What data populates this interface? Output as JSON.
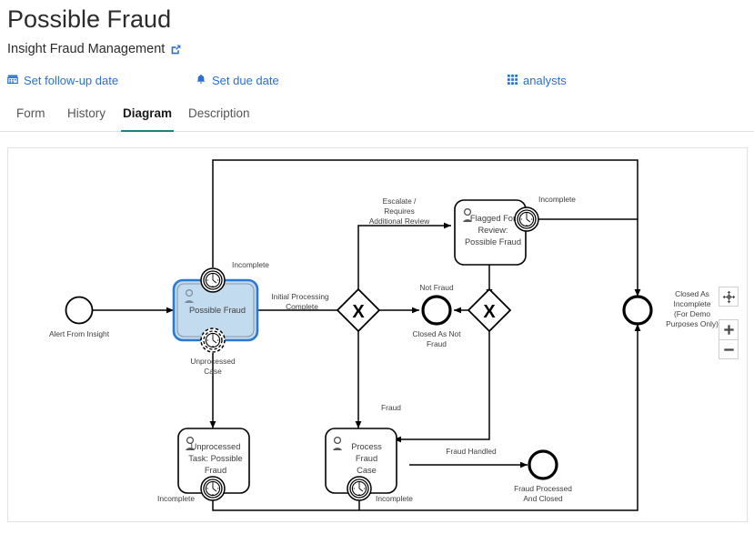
{
  "header": {
    "title": "Possible Fraud",
    "subtitle": "Insight Fraud Management",
    "subtitle_link_icon": "external-link-icon"
  },
  "quick_actions": [
    {
      "icon": "calendar-icon",
      "label": "Set follow-up date"
    },
    {
      "icon": "bell-icon",
      "label": "Set due date"
    },
    {
      "icon": "grid-apps-icon",
      "label": "analysts"
    }
  ],
  "tabs": [
    {
      "label": "Form",
      "active": false
    },
    {
      "label": "History",
      "active": false
    },
    {
      "label": "Diagram",
      "active": true
    },
    {
      "label": "Description",
      "active": false
    }
  ],
  "zoom_controls": [
    {
      "icon": "fit-to-screen-icon",
      "label": ""
    },
    {
      "icon": "plus-icon",
      "label": "+"
    },
    {
      "icon": "minus-icon",
      "label": "−"
    }
  ],
  "colors": {
    "link": "#2a6fd4",
    "tab_active_underline": "#1a7f86",
    "highlight_stroke": "#2a7ad4",
    "highlight_fill": "#c3dbef",
    "highlight_text": "#7a8a99",
    "stroke": "#000000",
    "panel_border": "#e3e3e3"
  },
  "diagram": {
    "type": "bpmn-process",
    "start_events": [
      {
        "id": "start1",
        "label": "Alert From Insight"
      }
    ],
    "tasks": [
      {
        "id": "task_possible_fraud",
        "label": "Possible Fraud",
        "type": "user-task",
        "highlighted": true
      },
      {
        "id": "task_flagged_review",
        "label": "Flagged For Review: Possible Fraud",
        "type": "user-task",
        "highlighted": false
      },
      {
        "id": "task_unprocessed",
        "label": "Unprocessed Task: Possible Fraud",
        "type": "user-task",
        "highlighted": false
      },
      {
        "id": "task_process_fraud",
        "label": "Process Fraud Case",
        "type": "user-task",
        "highlighted": false
      }
    ],
    "boundary_events": [
      {
        "id": "be1",
        "attached_to": "task_possible_fraud",
        "label": "Incomplete",
        "timer": "solid"
      },
      {
        "id": "be2",
        "attached_to": "task_possible_fraud",
        "label": "Unprocessed Case",
        "timer": "dashed"
      },
      {
        "id": "be3",
        "attached_to": "task_flagged_review",
        "label": "Incomplete",
        "timer": "solid"
      },
      {
        "id": "be4",
        "attached_to": "task_unprocessed",
        "label": "Incomplete",
        "timer": "solid"
      },
      {
        "id": "be5",
        "attached_to": "task_process_fraud",
        "label": "Incomplete",
        "timer": "solid"
      }
    ],
    "gateways": [
      {
        "id": "gw1",
        "type": "exclusive",
        "symbol": "X"
      },
      {
        "id": "gw2",
        "type": "exclusive",
        "symbol": "X"
      }
    ],
    "end_events": [
      {
        "id": "end_not_fraud",
        "label": "Closed As Not Fraud"
      },
      {
        "id": "end_incomplete",
        "label": "Closed As Incomplete (For Demo Purposes Only)"
      },
      {
        "id": "end_fraud_closed",
        "label": "Fraud Processed And Closed"
      }
    ],
    "flow_labels": [
      {
        "id": "fl_initial",
        "label": "Initial Processing Complete"
      },
      {
        "id": "fl_escalate",
        "label": "Escalate / Requires Additional Review"
      },
      {
        "id": "fl_not_fraud",
        "label": "Not Fraud"
      },
      {
        "id": "fl_fraud",
        "label": "Fraud"
      },
      {
        "id": "fl_fraud_handled",
        "label": "Fraud Handled"
      }
    ],
    "text": {
      "alert_from_insight": "Alert From Insight",
      "possible_fraud": "Possible Fraud",
      "incomplete": "Incomplete",
      "unprocessed_case_l1": "Unprocessed",
      "unprocessed_case_l2": "Case",
      "initial_processing_l1": "Initial Processing",
      "initial_processing_l2": "Complete",
      "escalate_l1": "Escalate /",
      "escalate_l2": "Requires",
      "escalate_l3": "Additional Review",
      "flagged_l1": "Flagged For",
      "flagged_l2": "Review:",
      "flagged_l3": "Possible Fraud",
      "not_fraud": "Not Fraud",
      "closed_not_fraud_l1": "Closed As Not",
      "closed_not_fraud_l2": "Fraud",
      "closed_incomplete_l1": "Closed As",
      "closed_incomplete_l2": "Incomplete",
      "closed_incomplete_l3": "(For Demo",
      "closed_incomplete_l4": "Purposes Only)",
      "fraud": "Fraud",
      "unprocessed_task_l1": "Unprocessed",
      "unprocessed_task_l2": "Task: Possible",
      "unprocessed_task_l3": "Fraud",
      "process_fraud_l1": "Process",
      "process_fraud_l2": "Fraud",
      "process_fraud_l3": "Case",
      "fraud_handled": "Fraud Handled",
      "fraud_processed_l1": "Fraud Processed",
      "fraud_processed_l2": "And Closed"
    }
  }
}
